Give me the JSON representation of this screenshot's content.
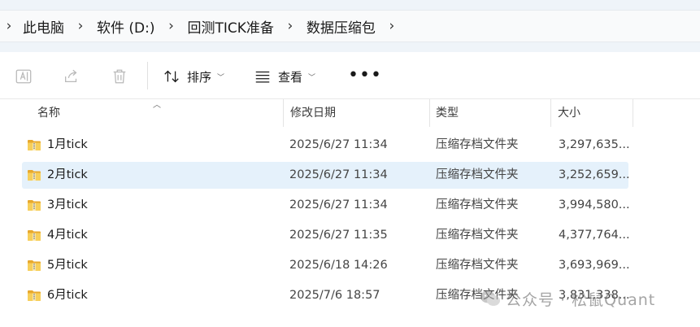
{
  "breadcrumb": {
    "items": [
      "此电脑",
      "软件 (D:)",
      "回测TICK准备",
      "数据压缩包"
    ]
  },
  "toolbar": {
    "sort_label": "排序",
    "view_label": "查看",
    "more_label": "•••",
    "icons": [
      "rename-icon",
      "share-icon",
      "delete-icon"
    ]
  },
  "columns": {
    "name": "名称",
    "date": "修改日期",
    "type": "类型",
    "size": "大小"
  },
  "files": [
    {
      "name": "1月tick",
      "date": "2025/6/27 11:34",
      "type": "压缩存档文件夹",
      "size": "3,297,635...",
      "selected": false
    },
    {
      "name": "2月tick",
      "date": "2025/6/27 11:34",
      "type": "压缩存档文件夹",
      "size": "3,252,659...",
      "selected": true
    },
    {
      "name": "3月tick",
      "date": "2025/6/27 11:34",
      "type": "压缩存档文件夹",
      "size": "3,994,580...",
      "selected": false
    },
    {
      "name": "4月tick",
      "date": "2025/6/27 11:35",
      "type": "压缩存档文件夹",
      "size": "4,377,764...",
      "selected": false
    },
    {
      "name": "5月tick",
      "date": "2025/6/18 14:26",
      "type": "压缩存档文件夹",
      "size": "3,693,969...",
      "selected": false
    },
    {
      "name": "6月tick",
      "date": "2025/7/6 18:57",
      "type": "压缩存档文件夹",
      "size": "3,831,338...",
      "selected": false
    }
  ],
  "watermark": {
    "text": "公众号 · 松鼠Quant"
  },
  "colors": {
    "selected_row": "#e5f1fb",
    "folder_yellow": "#f2c44a"
  }
}
